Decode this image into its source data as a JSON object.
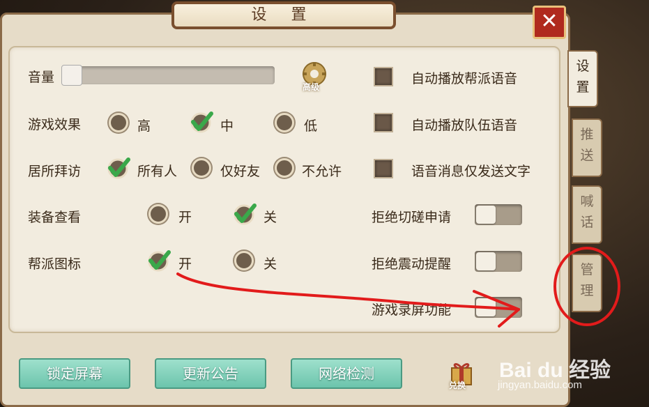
{
  "window": {
    "title": "设 置",
    "close_label": "✕"
  },
  "tabs": [
    {
      "line1": "设",
      "line2": "置"
    },
    {
      "line1": "推",
      "line2": "送"
    },
    {
      "line1": "喊",
      "line2": "话"
    },
    {
      "line1": "管",
      "line2": "理"
    }
  ],
  "volume": {
    "label": "音量",
    "level": 0.0,
    "advanced_label": "高级"
  },
  "game_effect": {
    "label": "游戏效果",
    "options": [
      "高",
      "中",
      "低"
    ],
    "selected": "中"
  },
  "residence_visit": {
    "label": "居所拜访",
    "options": [
      "所有人",
      "仅好友",
      "不允许"
    ],
    "selected": "所有人"
  },
  "equipment_view": {
    "label": "装备查看",
    "options": [
      "开",
      "关"
    ],
    "selected": "关"
  },
  "guild_icon": {
    "label": "帮派图标",
    "options": [
      "开",
      "关"
    ],
    "selected": "开"
  },
  "checkboxes": [
    {
      "label": "自动播放帮派语音",
      "checked": false
    },
    {
      "label": "自动播放队伍语音",
      "checked": false
    },
    {
      "label": "语音消息仅发送文字",
      "checked": false
    }
  ],
  "toggles": [
    {
      "label": "拒绝切磋申请",
      "on": false
    },
    {
      "label": "拒绝震动提醒",
      "on": false
    },
    {
      "label": "游戏录屏功能",
      "on": false
    }
  ],
  "buttons": {
    "lock_screen": "锁定屏幕",
    "update_notice": "更新公告",
    "network_check": "网络检测"
  },
  "gift": {
    "label": "兑换"
  },
  "watermark": {
    "brand": "Bai du 经验",
    "url": "jingyan.baidu.com"
  },
  "colors": {
    "accent": "#6cc4ac",
    "close": "#b02a1e",
    "annotation": "#e21b1b"
  }
}
